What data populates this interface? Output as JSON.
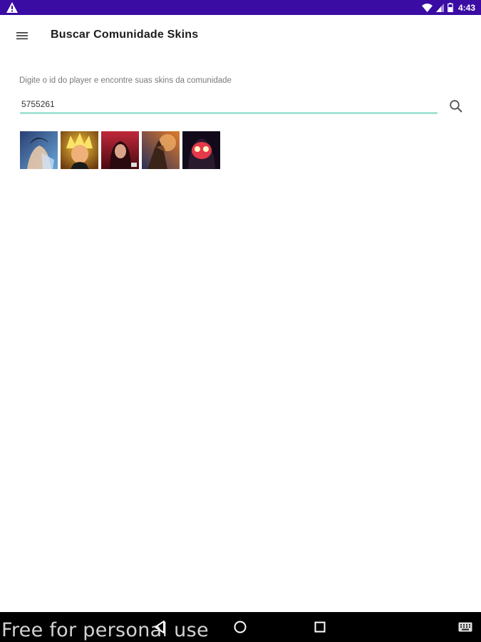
{
  "status_bar": {
    "time": "4:43",
    "icons": [
      "warning-icon",
      "wifi-icon",
      "signal-icon",
      "battery-icon"
    ]
  },
  "app_bar": {
    "title": "Buscar Comunidade Skins",
    "menu_icon": "menu-icon"
  },
  "search": {
    "hint": "Digite o id do player e encontre suas skins da comunidade",
    "value": "5755261",
    "button_icon": "search-icon",
    "underline_color": "#a6e4d4"
  },
  "skins": [
    {
      "name": "skin-1",
      "colors": [
        "#2a3f73",
        "#6aa6d6"
      ]
    },
    {
      "name": "skin-2",
      "colors": [
        "#6b3a10",
        "#f2c23a"
      ]
    },
    {
      "name": "skin-3",
      "colors": [
        "#4a0a10",
        "#c0283a"
      ]
    },
    {
      "name": "skin-4",
      "colors": [
        "#2a2f5a",
        "#e07a2a"
      ]
    },
    {
      "name": "skin-5",
      "colors": [
        "#120a1a",
        "#e43a4a"
      ]
    }
  ],
  "nav_bar": {
    "icons": [
      "back-icon",
      "home-icon",
      "recents-icon",
      "keyboard-icon"
    ]
  },
  "watermark": "Free for personal use",
  "colors": {
    "status_bar": "#3a0ca3",
    "nav_bar": "#000000"
  }
}
